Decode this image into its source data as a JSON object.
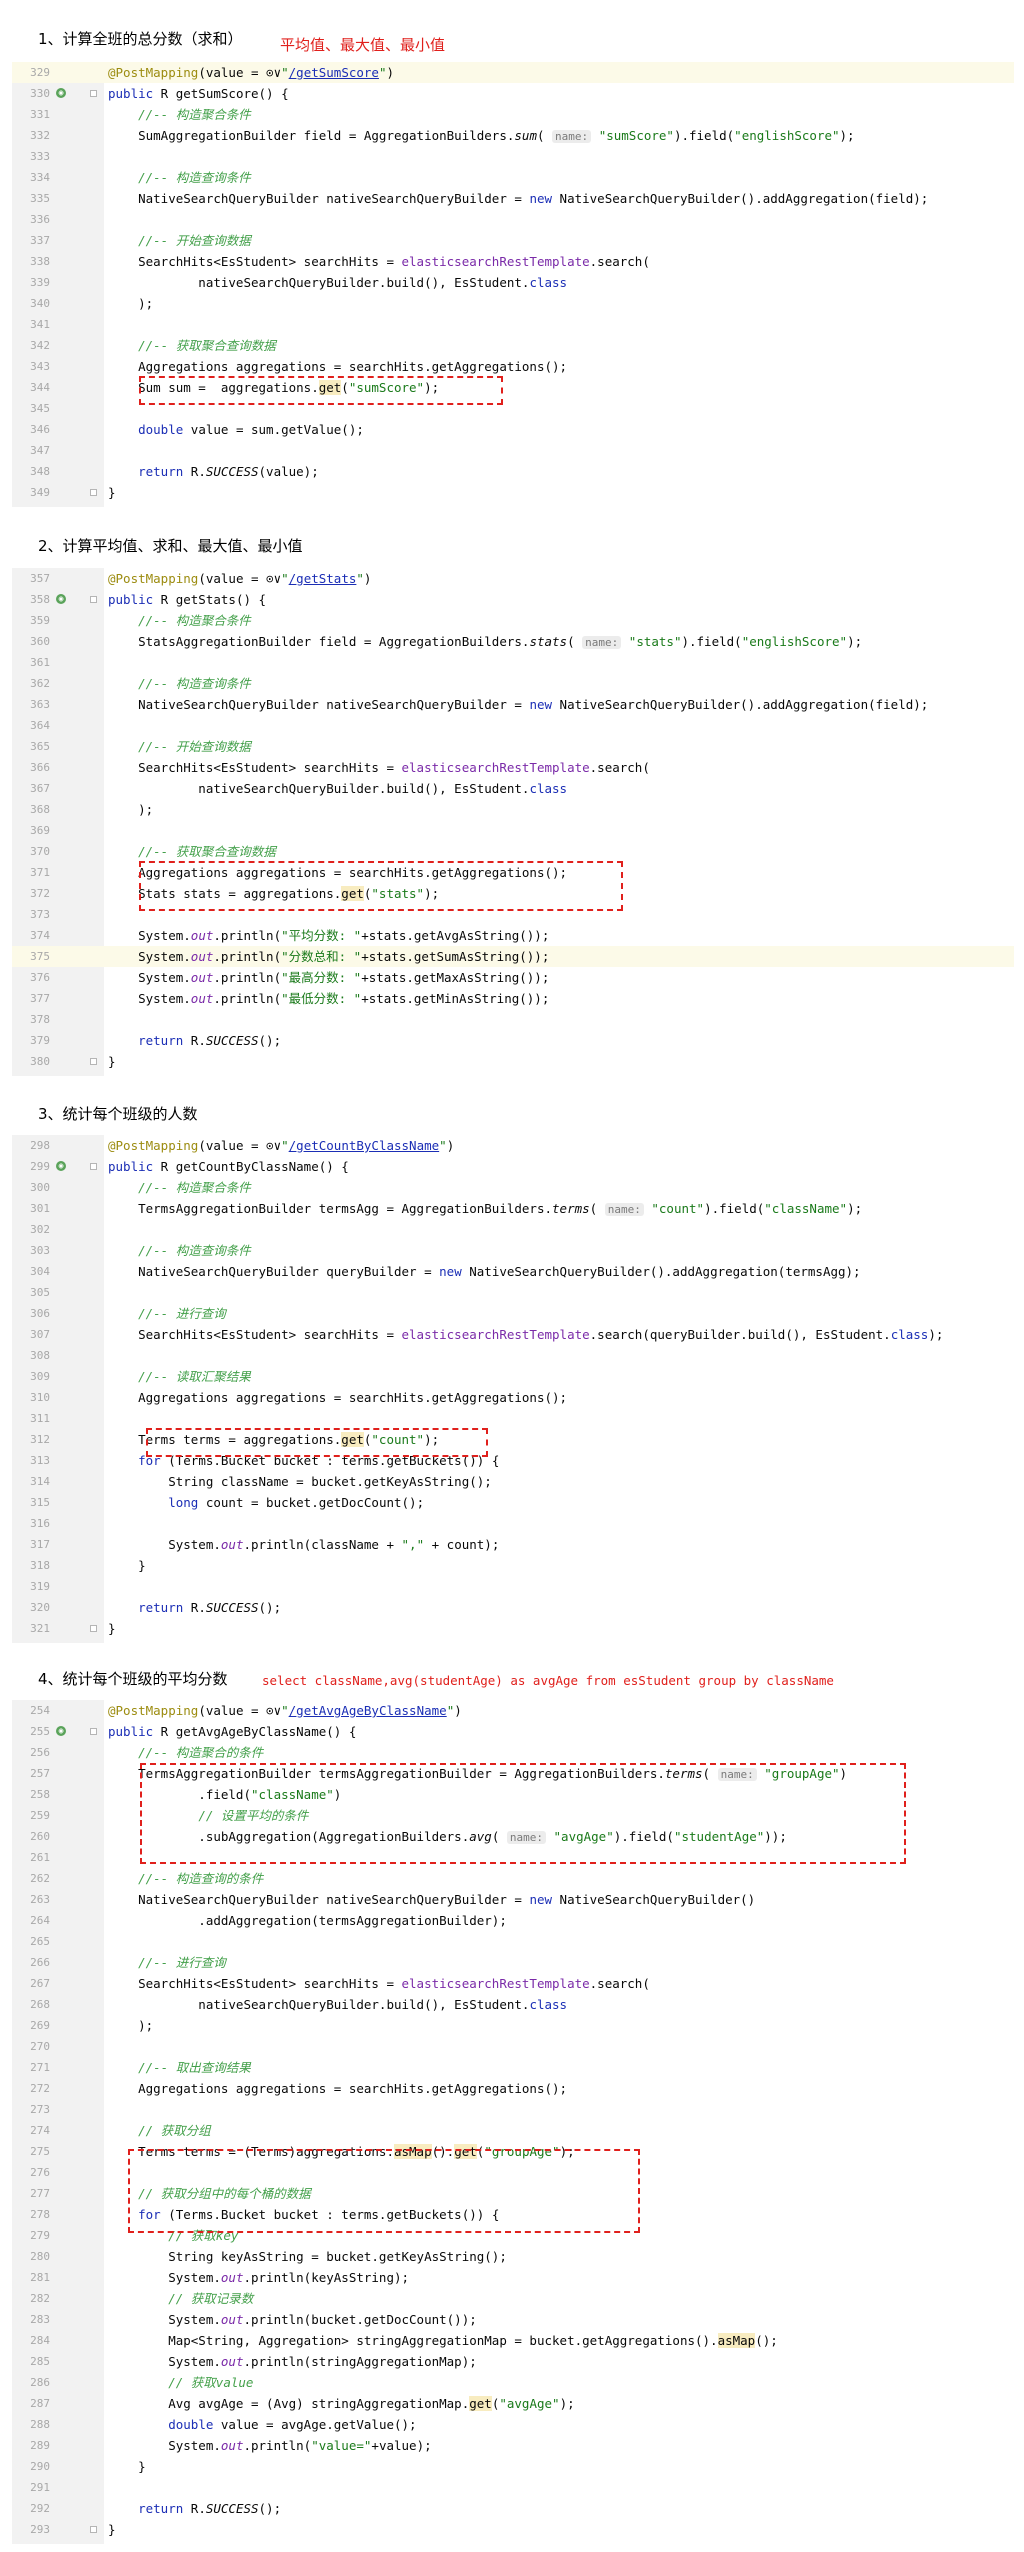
{
  "sections": [
    {
      "heading": "1、计算全班的总分数（求和）",
      "note": "平均值、最大值、最小值",
      "lines": [
        {
          "n": "329",
          "t": "@PostMapping(value = ⊙∨\"/getSumScore\")"
        },
        {
          "n": "330",
          "t": "public R getSumScore() {"
        },
        {
          "n": "331",
          "t": "    //-- 构造聚合条件"
        },
        {
          "n": "332",
          "t": "    SumAggregationBuilder field = AggregationBuilders.sum( name: \"sumScore\").field(\"englishScore\");"
        },
        {
          "n": "333",
          "t": ""
        },
        {
          "n": "334",
          "t": "    //-- 构造查询条件"
        },
        {
          "n": "335",
          "t": "    NativeSearchQueryBuilder nativeSearchQueryBuilder = new NativeSearchQueryBuilder().addAggregation(field);"
        },
        {
          "n": "336",
          "t": ""
        },
        {
          "n": "337",
          "t": "    //-- 开始查询数据"
        },
        {
          "n": "338",
          "t": "    SearchHits<EsStudent> searchHits = elasticsearchRestTemplate.search("
        },
        {
          "n": "339",
          "t": "            nativeSearchQueryBuilder.build(), EsStudent.class"
        },
        {
          "n": "340",
          "t": "    );"
        },
        {
          "n": "341",
          "t": ""
        },
        {
          "n": "342",
          "t": "    //-- 获取聚合查询数据"
        },
        {
          "n": "343",
          "t": "    Aggregations aggregations = searchHits.getAggregations();"
        },
        {
          "n": "344",
          "t": "    Sum sum =  aggregations.get(\"sumScore\");"
        },
        {
          "n": "345",
          "t": ""
        },
        {
          "n": "346",
          "t": "    double value = sum.getValue();"
        },
        {
          "n": "347",
          "t": ""
        },
        {
          "n": "348",
          "t": "    return R.SUCCESS(value);"
        },
        {
          "n": "349",
          "t": "}"
        }
      ]
    },
    {
      "heading": "2、计算平均值、求和、最大值、最小值",
      "note": "",
      "lines": [
        {
          "n": "357",
          "t": "@PostMapping(value = ⊙∨\"/getStats\")"
        },
        {
          "n": "358",
          "t": "public R getStats() {"
        },
        {
          "n": "359",
          "t": "    //-- 构造聚合条件"
        },
        {
          "n": "360",
          "t": "    StatsAggregationBuilder field = AggregationBuilders.stats( name: \"stats\").field(\"englishScore\");"
        },
        {
          "n": "361",
          "t": ""
        },
        {
          "n": "362",
          "t": "    //-- 构造查询条件"
        },
        {
          "n": "363",
          "t": "    NativeSearchQueryBuilder nativeSearchQueryBuilder = new NativeSearchQueryBuilder().addAggregation(field);"
        },
        {
          "n": "364",
          "t": ""
        },
        {
          "n": "365",
          "t": "    //-- 开始查询数据"
        },
        {
          "n": "366",
          "t": "    SearchHits<EsStudent> searchHits = elasticsearchRestTemplate.search("
        },
        {
          "n": "367",
          "t": "            nativeSearchQueryBuilder.build(), EsStudent.class"
        },
        {
          "n": "368",
          "t": "    );"
        },
        {
          "n": "369",
          "t": ""
        },
        {
          "n": "370",
          "t": "    //-- 获取聚合查询数据"
        },
        {
          "n": "371",
          "t": "    Aggregations aggregations = searchHits.getAggregations();"
        },
        {
          "n": "372",
          "t": "    Stats stats = aggregations.get(\"stats\");"
        },
        {
          "n": "373",
          "t": ""
        },
        {
          "n": "374",
          "t": "    System.out.println(\"平均分数: \"+stats.getAvgAsString());"
        },
        {
          "n": "375",
          "t": "    System.out.println(\"分数总和: \"+stats.getSumAsString());"
        },
        {
          "n": "376",
          "t": "    System.out.println(\"最高分数: \"+stats.getMaxAsString());"
        },
        {
          "n": "377",
          "t": "    System.out.println(\"最低分数: \"+stats.getMinAsString());"
        },
        {
          "n": "378",
          "t": ""
        },
        {
          "n": "379",
          "t": "    return R.SUCCESS();"
        },
        {
          "n": "380",
          "t": "}"
        }
      ]
    },
    {
      "heading": "3、统计每个班级的人数",
      "note": "",
      "lines": [
        {
          "n": "298",
          "t": "@PostMapping(value = ⊙∨\"/getCountByClassName\")"
        },
        {
          "n": "299",
          "t": "public R getCountByClassName() {"
        },
        {
          "n": "300",
          "t": "    //-- 构造聚合条件"
        },
        {
          "n": "301",
          "t": "    TermsAggregationBuilder termsAgg = AggregationBuilders.terms( name: \"count\").field(\"className\");"
        },
        {
          "n": "302",
          "t": ""
        },
        {
          "n": "303",
          "t": "    //-- 构造查询条件"
        },
        {
          "n": "304",
          "t": "    NativeSearchQueryBuilder queryBuilder = new NativeSearchQueryBuilder().addAggregation(termsAgg);"
        },
        {
          "n": "305",
          "t": ""
        },
        {
          "n": "306",
          "t": "    //-- 进行查询"
        },
        {
          "n": "307",
          "t": "    SearchHits<EsStudent> searchHits = elasticsearchRestTemplate.search(queryBuilder.build(), EsStudent.class);"
        },
        {
          "n": "308",
          "t": ""
        },
        {
          "n": "309",
          "t": "    //-- 读取汇聚结果"
        },
        {
          "n": "310",
          "t": "    Aggregations aggregations = searchHits.getAggregations();"
        },
        {
          "n": "311",
          "t": ""
        },
        {
          "n": "312",
          "t": "    Terms terms = aggregations.get(\"count\");"
        },
        {
          "n": "313",
          "t": "    for (Terms.Bucket bucket : terms.getBuckets()) {"
        },
        {
          "n": "314",
          "t": "        String className = bucket.getKeyAsString();"
        },
        {
          "n": "315",
          "t": "        long count = bucket.getDocCount();"
        },
        {
          "n": "316",
          "t": ""
        },
        {
          "n": "317",
          "t": "        System.out.println(className + \",\" + count);"
        },
        {
          "n": "318",
          "t": "    }"
        },
        {
          "n": "319",
          "t": ""
        },
        {
          "n": "320",
          "t": "    return R.SUCCESS();"
        },
        {
          "n": "321",
          "t": "}"
        }
      ]
    },
    {
      "heading": "4、统计每个班级的平均分数",
      "note": "select className,avg(studentAge) as avgAge from esStudent group by className",
      "lines": [
        {
          "n": "254",
          "t": "@PostMapping(value = ⊙∨\"/getAvgAgeByClassName\")"
        },
        {
          "n": "255",
          "t": "public R getAvgAgeByClassName() {"
        },
        {
          "n": "256",
          "t": "    //-- 构造聚合的条件"
        },
        {
          "n": "257",
          "t": "    TermsAggregationBuilder termsAggregationBuilder = AggregationBuilders.terms( name: \"groupAge\")"
        },
        {
          "n": "258",
          "t": "            .field(\"className\")"
        },
        {
          "n": "259",
          "t": "            // 设置平均的条件"
        },
        {
          "n": "260",
          "t": "            .subAggregation(AggregationBuilders.avg( name: \"avgAge\").field(\"studentAge\"));"
        },
        {
          "n": "261",
          "t": ""
        },
        {
          "n": "262",
          "t": "    //-- 构造查询的条件"
        },
        {
          "n": "263",
          "t": "    NativeSearchQueryBuilder nativeSearchQueryBuilder = new NativeSearchQueryBuilder()"
        },
        {
          "n": "264",
          "t": "            .addAggregation(termsAggregationBuilder);"
        },
        {
          "n": "265",
          "t": ""
        },
        {
          "n": "266",
          "t": "    //-- 进行查询"
        },
        {
          "n": "267",
          "t": "    SearchHits<EsStudent> searchHits = elasticsearchRestTemplate.search("
        },
        {
          "n": "268",
          "t": "            nativeSearchQueryBuilder.build(), EsStudent.class"
        },
        {
          "n": "269",
          "t": "    );"
        },
        {
          "n": "270",
          "t": ""
        },
        {
          "n": "271",
          "t": "    //-- 取出查询结果"
        },
        {
          "n": "272",
          "t": "    Aggregations aggregations = searchHits.getAggregations();"
        },
        {
          "n": "273",
          "t": ""
        },
        {
          "n": "274",
          "t": "    // 获取分组"
        },
        {
          "n": "275",
          "t": "    Terms terms = (Terms)aggregations.asMap().get(\"groupAge\");"
        },
        {
          "n": "276",
          "t": ""
        },
        {
          "n": "277",
          "t": "    // 获取分组中的每个桶的数据"
        },
        {
          "n": "278",
          "t": "    for (Terms.Bucket bucket : terms.getBuckets()) {"
        },
        {
          "n": "279",
          "t": "        // 获取key"
        },
        {
          "n": "280",
          "t": "        String keyAsString = bucket.getKeyAsString();"
        },
        {
          "n": "281",
          "t": "        System.out.println(keyAsString);"
        },
        {
          "n": "282",
          "t": "        // 获取记录数"
        },
        {
          "n": "283",
          "t": "        System.out.println(bucket.getDocCount());"
        },
        {
          "n": "284",
          "t": "        Map<String, Aggregation> stringAggregationMap = bucket.getAggregations().asMap();"
        },
        {
          "n": "285",
          "t": "        System.out.println(stringAggregationMap);"
        },
        {
          "n": "286",
          "t": "        // 获取value"
        },
        {
          "n": "287",
          "t": "        Avg avgAge = (Avg) stringAggregationMap.get(\"avgAge\");"
        },
        {
          "n": "288",
          "t": "        double value = avgAge.getValue();"
        },
        {
          "n": "289",
          "t": "        System.out.println(\"value=\"+value);"
        },
        {
          "n": "290",
          "t": "    }"
        },
        {
          "n": "291",
          "t": ""
        },
        {
          "n": "292",
          "t": "    return R.SUCCESS();"
        },
        {
          "n": "293",
          "t": "}"
        }
      ]
    }
  ]
}
